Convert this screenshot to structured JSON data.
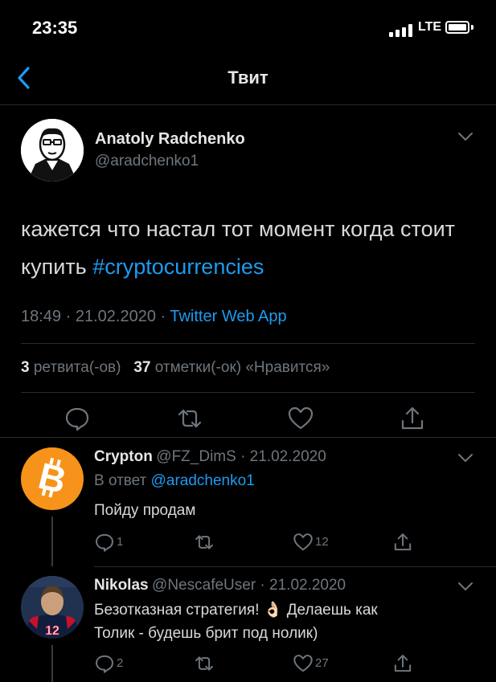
{
  "status": {
    "time": "23:35",
    "network": "LTE"
  },
  "header": {
    "title": "Твит"
  },
  "tweet": {
    "author_name": "Anatoly Radchenko",
    "author_handle": "@aradchenko1",
    "text_plain": "кажется что настал тот момент когда стоит купить ",
    "hashtag": "#cryptocurrencies",
    "time": "18:49",
    "separator": " · ",
    "date": "21.02.2020",
    "source": "Twitter Web App",
    "retweets_count": "3",
    "retweets_label": "ретвита(-ов)",
    "likes_count": "37",
    "likes_label": "отметки(-ок) «Нравится»"
  },
  "replies": [
    {
      "name": "Crypton",
      "handle_date": "@FZ_DimS · 21.02.2020",
      "reply_to_prefix": "В ответ ",
      "reply_to_handle": "@aradchenko1",
      "text": "Пойду продам",
      "comments": "1",
      "retweets": "",
      "likes": "12",
      "avatar_color": "#f7931a"
    },
    {
      "name": "Nikolas",
      "handle_date": "@NescafeUser · 21.02.2020",
      "text_line1": "Безотказная стратегия! 👌🏻 Делаешь как",
      "text_line2": "Толик - будешь брит под нолик)",
      "comments": "2",
      "retweets": "",
      "likes": "27",
      "jersey_number": "12"
    }
  ]
}
